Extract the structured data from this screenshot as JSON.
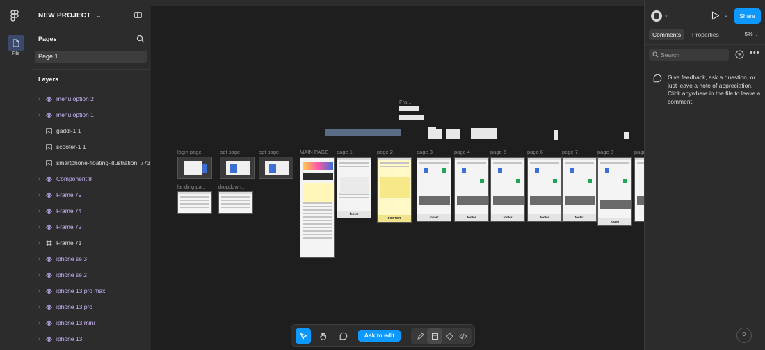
{
  "project": {
    "name": "NEW PROJECT"
  },
  "rail": {
    "file_label": "File"
  },
  "pages": {
    "title": "Pages",
    "items": [
      "Page 1"
    ]
  },
  "layers": {
    "title": "Layers",
    "items": [
      {
        "name": "menu option 2",
        "kind": "component"
      },
      {
        "name": "menu option 1",
        "kind": "component"
      },
      {
        "name": "gaddi-1 1",
        "kind": "image"
      },
      {
        "name": "scooter-1 1",
        "kind": "image"
      },
      {
        "name": "smartphone-floating-illustration_773",
        "kind": "image"
      },
      {
        "name": "Component 8",
        "kind": "component"
      },
      {
        "name": "Frame 79",
        "kind": "component"
      },
      {
        "name": "Frame 74",
        "kind": "component"
      },
      {
        "name": "Frame 72",
        "kind": "component"
      },
      {
        "name": "Frame 71",
        "kind": "frame"
      },
      {
        "name": "iphone se 3",
        "kind": "component"
      },
      {
        "name": "iphone se 2",
        "kind": "component"
      },
      {
        "name": "iphone 13 pro max",
        "kind": "component"
      },
      {
        "name": "iphone 13 pro",
        "kind": "component"
      },
      {
        "name": "iphone 13 mini",
        "kind": "component"
      },
      {
        "name": "iphone 13",
        "kind": "component"
      }
    ]
  },
  "canvas": {
    "frame_labels": {
      "fra": "Fra...",
      "login": "login page",
      "opt1": "opt page",
      "opt2": "opt page",
      "main": "MAIN PAGE",
      "p1": "page 1",
      "p2": "page 2",
      "p3": "page 3",
      "p4": "page 4",
      "p5": "page 5",
      "p6": "page 6",
      "p7": "page 7",
      "p8": "page 8",
      "p9": "page",
      "landing": "landing pa...",
      "dropdown": "dropdown..."
    },
    "footer_texts": {
      "p1": "footer",
      "p2": "FOOTER",
      "p3": "footer",
      "p4": "footer",
      "p5": "footer",
      "p6": "footer",
      "p7": "footer",
      "p8": "footer"
    }
  },
  "toolbar": {
    "ask_to_edit": "Ask to edit"
  },
  "right_panel": {
    "share_label": "Share",
    "tabs": [
      "Comments",
      "Properties"
    ],
    "zoom": "5%",
    "search_placeholder": "Search",
    "feedback": "Give feedback, ask a question, or just leave a note of appreciation. Click anywhere in the file to leave a comment."
  },
  "help_label": "?",
  "colors": {
    "accent": "#0d99ff",
    "component_purple": "#c7b3f5",
    "canvas_bg": "#1e1e1e",
    "panel_bg": "#2c2c2c"
  },
  "icons": [
    "figma-logo-icon",
    "file-icon",
    "panel-toggle-icon",
    "search-icon",
    "component-icon",
    "image-icon",
    "frame-icon",
    "move-tool-icon",
    "hand-tool-icon",
    "comment-icon",
    "play-icon",
    "filter-icon",
    "more-icon",
    "help-icon"
  ]
}
